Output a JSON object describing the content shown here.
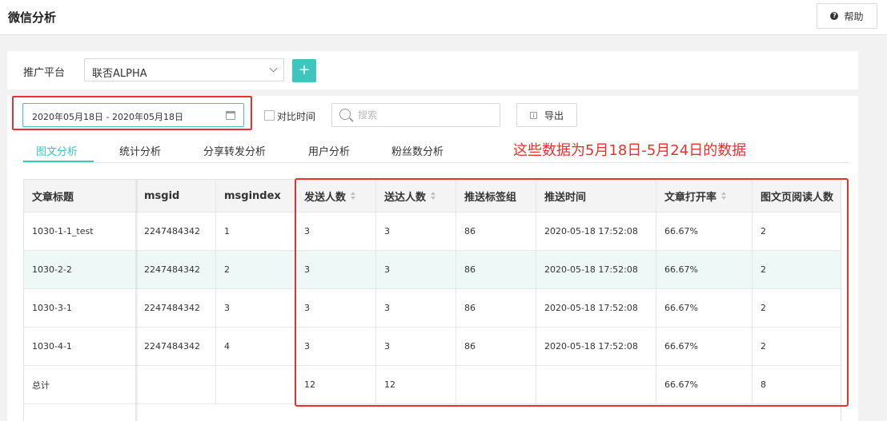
{
  "header": {
    "title": "微信分析",
    "help_label": "帮助"
  },
  "platform": {
    "label": "推广平台",
    "selected": "联否ALPHA",
    "add_label": "+"
  },
  "filters": {
    "date_range": "2020年05月18日 - 2020年05月18日",
    "compare_label": "对比时间",
    "search_placeholder": "搜索",
    "export_label": "导出"
  },
  "tabs": [
    {
      "label": "图文分析",
      "active": true
    },
    {
      "label": "统计分析"
    },
    {
      "label": "分享转发分析"
    },
    {
      "label": "用户分析"
    },
    {
      "label": "粉丝数分析"
    }
  ],
  "annotation": "这些数据为5月18日-5月24日的数据",
  "table": {
    "columns": [
      "文章标题",
      "msgid",
      "msgindex",
      "发送人数",
      "送达人数",
      "推送标签组",
      "推送时间",
      "文章打开率",
      "图文页阅读人数"
    ],
    "rows": [
      [
        "1030-1-1_test",
        "2247484342",
        "1",
        "3",
        "3",
        "86",
        "2020-05-18 17:52:08",
        "66.67%",
        "2"
      ],
      [
        "1030-2-2",
        "2247484342",
        "2",
        "3",
        "3",
        "86",
        "2020-05-18 17:52:08",
        "66.67%",
        "2"
      ],
      [
        "1030-3-1",
        "2247484342",
        "3",
        "3",
        "3",
        "86",
        "2020-05-18 17:52:08",
        "66.67%",
        "2"
      ],
      [
        "1030-4-1",
        "2247484342",
        "4",
        "3",
        "3",
        "86",
        "2020-05-18 17:52:08",
        "66.67%",
        "2"
      ],
      [
        "总计",
        "",
        "",
        "12",
        "12",
        "",
        "",
        "66.67%",
        "8"
      ]
    ]
  }
}
